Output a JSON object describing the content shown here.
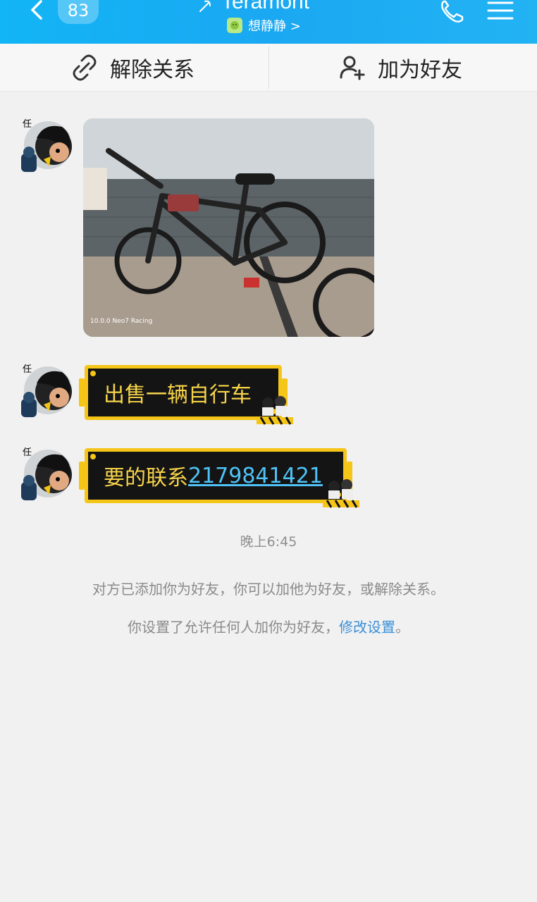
{
  "header": {
    "unread_count": "83",
    "title": "Teramont",
    "subtitle": "想静静 >",
    "back_icon": "chevron-left-icon",
    "phone_icon": "phone-icon",
    "menu_icon": "menu-icon",
    "bar_color": "#1aa8f2"
  },
  "action_bar": {
    "unlink_label": "解除关系",
    "add_friend_label": "加为好友"
  },
  "messages": [
    {
      "type": "image",
      "caption": "10.0.0 Neo7 Racing"
    },
    {
      "type": "text",
      "text": "出售一辆自行车"
    },
    {
      "type": "text",
      "text_prefix": "要的联系",
      "link": "2179841421"
    }
  ],
  "timestamp": "晚上6:45",
  "system_notices": {
    "line1": "对方已添加你为好友，你可以加他为好友，或解除关系。",
    "line2_prefix": "你设置了允许任何人加你为好友，",
    "line2_link": "修改设置",
    "line2_suffix": "。"
  },
  "colors": {
    "bubble_border": "#f5c518",
    "bubble_text": "#f7d44a",
    "link": "#4fc3f7",
    "settings_link": "#3a8fd8"
  }
}
